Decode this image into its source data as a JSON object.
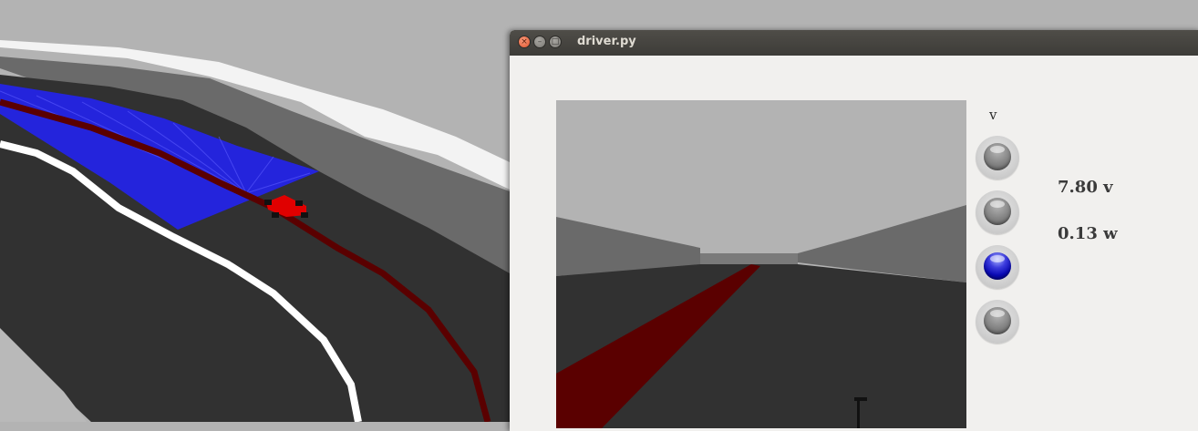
{
  "window": {
    "title": "driver.py",
    "close_glyph": "×",
    "minimize_glyph": "–",
    "maximize_glyph": "□"
  },
  "panel": {
    "indicator_header": "v",
    "indicators": [
      {
        "name": "led-indicator-1",
        "state": "off"
      },
      {
        "name": "led-indicator-2",
        "state": "off"
      },
      {
        "name": "led-indicator-3",
        "state": "on"
      },
      {
        "name": "led-indicator-4",
        "state": "off"
      }
    ],
    "linear_velocity": "7.80 v",
    "angular_velocity": "0.13 w"
  },
  "colors": {
    "track": "#313131",
    "sky": "#b3b3b3",
    "line": "#5a0000",
    "laser": "#2020ff",
    "led_on": "#0a0ab4",
    "car": "#e00000"
  }
}
